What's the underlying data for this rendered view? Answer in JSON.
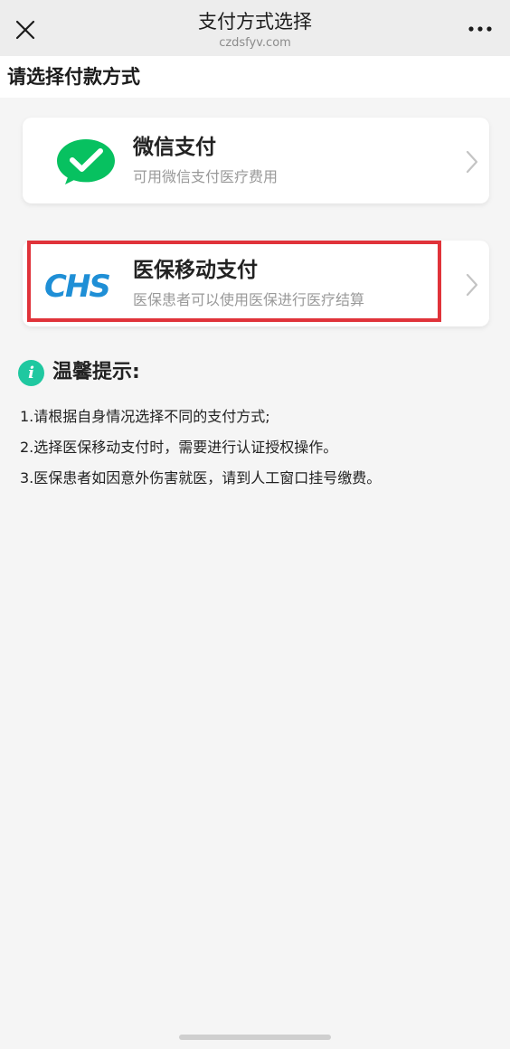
{
  "nav": {
    "title": "支付方式选择",
    "subtitle": "czdsfyv.com",
    "close_icon": "close-icon",
    "more_icon": "more-icon"
  },
  "section": {
    "title": "请选择付款方式"
  },
  "payments": [
    {
      "name": "微信支付",
      "desc": "可用微信支付医疗费用",
      "logo": "wechat-pay-logo",
      "accent": "#07c160"
    },
    {
      "name": "医保移动支付",
      "desc": "医保患者可以使用医保进行医疗结算",
      "logo": "chs-logo",
      "logo_text": "CHS",
      "accent": "#1f8fd6"
    }
  ],
  "highlight_color": "#e0333a",
  "tips": {
    "title": "温馨提示:",
    "icon_label": "i",
    "icon_color": "#1fc8a0",
    "items": [
      "1.请根据自身情况选择不同的支付方式;",
      "2.选择医保移动支付时，需要进行认证授权操作。",
      "3.医保患者如因意外伤害就医，请到人工窗口挂号缴费。"
    ]
  }
}
